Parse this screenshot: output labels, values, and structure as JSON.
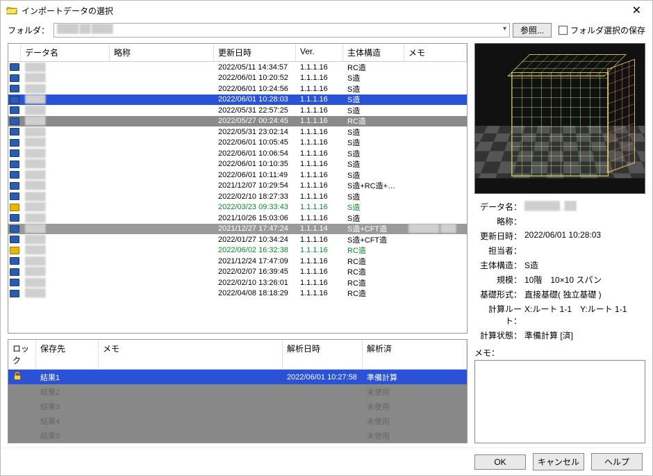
{
  "window": {
    "title": "インポートデータの選択"
  },
  "folderbar": {
    "label": "フォルダ：",
    "browse": "参照...",
    "save_chk": "フォルダ選択の保存"
  },
  "columns": {
    "data": "データ名",
    "abbr": "略称",
    "date": "更新日時",
    "ver": "Ver.",
    "struct": "主体構造",
    "memo": "メモ"
  },
  "rows": [
    {
      "d": "2022/05/11 14:34:57",
      "v": "1.1.1.16",
      "s": "RC造"
    },
    {
      "d": "2022/06/01 10:20:52",
      "v": "1.1.1.16",
      "s": "S造"
    },
    {
      "d": "2022/06/01 10:24:56",
      "v": "1.1.1.16",
      "s": "S造"
    },
    {
      "d": "2022/06/01 10:28:03",
      "v": "1.1.1.16",
      "s": "S造",
      "sel": 1
    },
    {
      "d": "2022/05/31 22:57:25",
      "v": "1.1.1.16",
      "s": "S造"
    },
    {
      "d": "2022/05/27 00:24:45",
      "v": "1.1.1.16",
      "s": "RC造",
      "sel": 2
    },
    {
      "d": "2022/05/31 23:02:14",
      "v": "1.1.1.16",
      "s": "S造"
    },
    {
      "d": "2022/06/01 10:05:45",
      "v": "1.1.1.16",
      "s": "S造"
    },
    {
      "d": "2022/06/01 10:06:54",
      "v": "1.1.1.16",
      "s": "S造"
    },
    {
      "d": "2022/06/01 10:10:35",
      "v": "1.1.1.16",
      "s": "S造"
    },
    {
      "d": "2022/06/01 10:11:49",
      "v": "1.1.1.16",
      "s": "S造"
    },
    {
      "d": "2021/12/07 10:29:54",
      "v": "1.1.1.16",
      "s": "S造+RC造+SRC..."
    },
    {
      "d": "2022/02/10 18:27:33",
      "v": "1.1.1.16",
      "s": "S造"
    },
    {
      "d": "2022/03/23 09:33:43",
      "v": "1.1.1.16",
      "s": "S造",
      "green": true
    },
    {
      "d": "2021/10/26 15:03:06",
      "v": "1.1.1.16",
      "s": "S造"
    },
    {
      "d": "2021/12/27 17:47:24",
      "v": "1.1.1.14",
      "s": "S造+CFT造",
      "sel": 3
    },
    {
      "d": "2022/01/27 10:34:24",
      "v": "1.1.1.16",
      "s": "S造+CFT造"
    },
    {
      "d": "2022/06/02 16:32:38",
      "v": "1.1.1.16",
      "s": "RC造",
      "green": true
    },
    {
      "d": "2021/12/24 17:47:09",
      "v": "1.1.1.16",
      "s": "RC造"
    },
    {
      "d": "2022/02/07 16:39:45",
      "v": "1.1.1.16",
      "s": "RC造"
    },
    {
      "d": "2022/02/10 13:26:01",
      "v": "1.1.1.16",
      "s": "RC造"
    },
    {
      "d": "2022/04/08 18:18:29",
      "v": "1.1.1.16",
      "s": "RC造"
    }
  ],
  "results": {
    "cols": {
      "lock": "ロック",
      "save": "保存先",
      "memo": "メモ",
      "adate": "解析日時",
      "done": "解析済"
    },
    "rows": [
      {
        "save": "結果1",
        "adate": "2022/06/01 10:27:58",
        "done": "準備計算",
        "sel": true
      },
      {
        "save": "結果2",
        "done": "未使用",
        "dis": true
      },
      {
        "save": "結果3",
        "done": "未使用",
        "dis": true
      },
      {
        "save": "結果4",
        "done": "未使用",
        "dis": true
      },
      {
        "save": "結果5",
        "done": "未使用",
        "dis": true
      }
    ]
  },
  "details": {
    "data_label": "データ名：",
    "abbr_label": "略称：",
    "date_label": "更新日時：",
    "date_val": "2022/06/01 10:28:03",
    "owner_label": "担当者：",
    "struct_label": "主体構造：",
    "struct_val": "S造",
    "scale_label": "規模：",
    "scale_val": "10階　10×10 スパン",
    "found_label": "基礎形式：",
    "found_val": "直接基礎( 独立基礎 )",
    "route_label": "計算ルート：",
    "route_val": "X:ルート 1-1　Y:ルート 1-1",
    "state_label": "計算状態：",
    "state_val": "準備計算 [済]",
    "memo_label": "メモ："
  },
  "footer": {
    "ok": "OK",
    "cancel": "キャンセル",
    "help": "ヘルプ"
  }
}
